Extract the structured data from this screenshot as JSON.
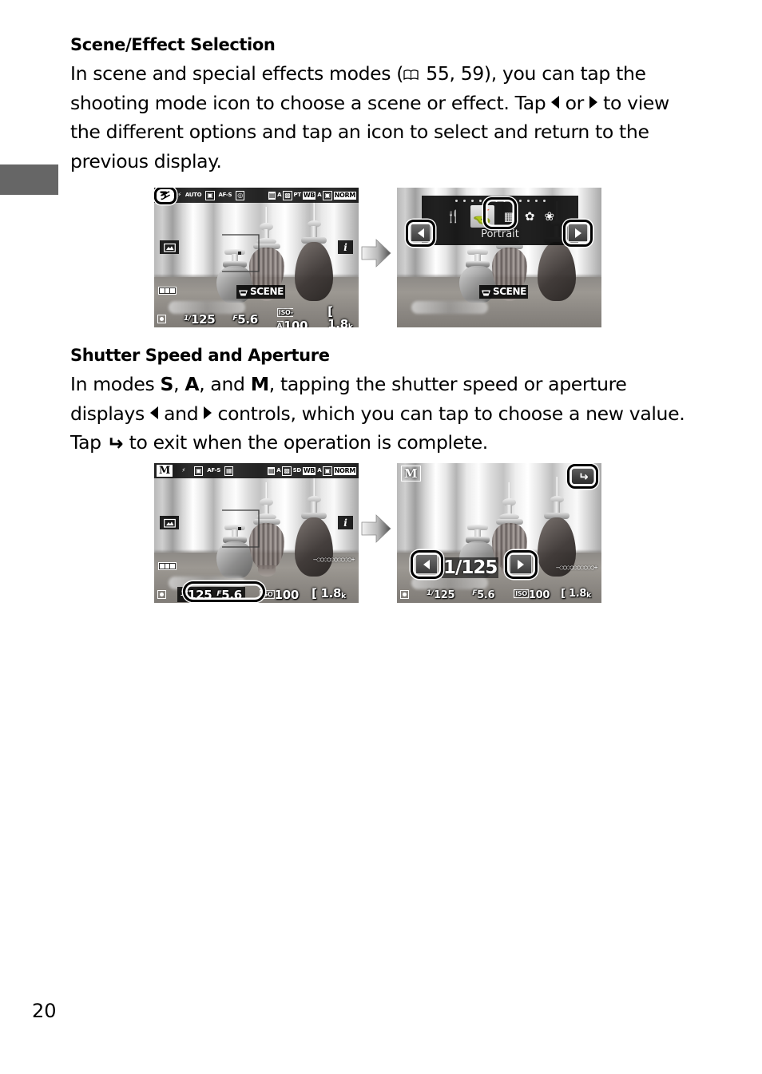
{
  "page": {
    "number": "20",
    "side_tab": "chapter-tab-marker"
  },
  "sections": [
    {
      "id": "scene_effect",
      "heading": "Scene/Effect Selection",
      "paragraph_parts": {
        "p1": "In scene and special effects modes (",
        "book_icon": "book-icon",
        "p2": " 55, 59), you can tap the shooting mode icon to choose a scene or effect.  Tap ",
        "arrow_left": "◀",
        "p3": " or ",
        "arrow_right": "▶",
        "p4": " to view the different options and tap an icon to select and return to the previous display."
      }
    },
    {
      "id": "shutter_aperture",
      "heading": "Shutter Speed and Aperture",
      "paragraph_parts": {
        "p1": "In modes ",
        "mode_s": "S",
        "p2": ", ",
        "mode_a": "A",
        "p3": ", and ",
        "mode_m": "M",
        "p4": ", tapping the shutter speed or aperture displays ",
        "arrow_left": "◀",
        "p5": " and ",
        "arrow_right": "▶",
        "p6": " controls, which you can tap to choose a new value.  Tap ",
        "undo": "↰",
        "p7": " to exit when the operation is complete."
      }
    }
  ],
  "figures": {
    "flow_arrow_icon": "right-arrow-icon",
    "scene_row": {
      "before": {
        "caption_name": "camera-live-view-scene-mode",
        "top_bar": {
          "mode_badge": "⛷",
          "flash": "AUTO",
          "flash_label": "AUTO",
          "metering": "matrix-metering-icon",
          "af_mode": "AF-S",
          "af_area": "af-area-icon",
          "release_mode": "release-mode-icon",
          "release_value": "A",
          "picture_control": "PT",
          "white_balance_label": "WB",
          "white_balance_value": "A",
          "image_quality": "NORM"
        },
        "left_icon": "touch-shutter-icon",
        "right_icon": "i",
        "battery": "battery-full-icon",
        "scene_badge": "SCENE",
        "bottom_bar": {
          "meter": "exposure-indicator-icon",
          "shutter_prefix": "1/",
          "shutter_speed": "125",
          "aperture_prefix": "F",
          "aperture": "5.6",
          "iso_prefix": "ISO-A",
          "iso": "100",
          "frames_open": "[",
          "frames": "1.8",
          "frames_unit": "k"
        }
      },
      "after": {
        "caption_name": "camera-scene-selection-overlay",
        "dots_count": 12,
        "scene_icons": [
          "🍴",
          "⛷",
          "▨",
          "✿",
          "❁"
        ],
        "selected_index": 1,
        "selected_label": "Portrait",
        "nav_prev": "◀",
        "nav_next": "▶",
        "scene_badge": "SCENE"
      }
    },
    "shutter_row": {
      "before": {
        "caption_name": "camera-live-view-manual-mode",
        "top_bar": {
          "mode_badge": "M",
          "flash": "flash-icon",
          "metering": "matrix-metering-icon",
          "af_mode": "AF-S",
          "af_area": "af-area-icon",
          "release_mode": "release-mode-icon",
          "release_value": "A",
          "picture_control": "SD",
          "white_balance_label": "WB",
          "white_balance_value": "A",
          "image_quality": "NORM"
        },
        "left_icon": "touch-shutter-icon",
        "right_icon": "i",
        "battery": "battery-full-icon",
        "bottom_bar": {
          "meter": "exposure-indicator-icon",
          "shutter_prefix": "1/",
          "shutter_speed": "125",
          "aperture_prefix": "F",
          "aperture": "5.6",
          "iso_prefix": "ISO",
          "iso": "100",
          "frames_open": "[",
          "frames": "1.8",
          "frames_unit": "k"
        }
      },
      "after": {
        "caption_name": "camera-shutter-speed-adjust",
        "mode_badge": "M",
        "back_button": "↰",
        "nav_prev": "◀",
        "nav_next": "▶",
        "shutter_readout": "1/125",
        "bottom_bar": {
          "meter": "exposure-indicator-icon",
          "shutter_prefix": "1/",
          "shutter_speed": "125",
          "aperture_prefix": "F",
          "aperture": "5.6",
          "iso_prefix": "ISO",
          "iso": "100",
          "frames_open": "[",
          "frames": "1.8",
          "frames_unit": "k"
        }
      }
    }
  },
  "colors": {
    "page_background": "#ffffff",
    "text": "#000000",
    "side_tab": "#666666",
    "osd_background": "#000000",
    "osd_text": "#ffffff"
  }
}
